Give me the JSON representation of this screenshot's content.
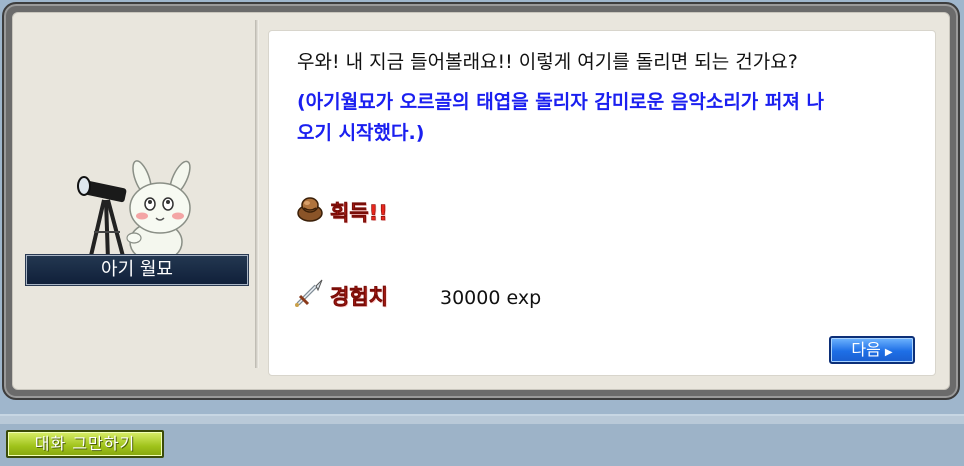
{
  "npc": {
    "name": "아기 월묘",
    "icon": "bunny-with-telescope-icon"
  },
  "dialogue": {
    "line1": "우와! 내 지금 들어볼래요!! 이렇게 여기를 돌리면 되는 건가요?",
    "line2": "(아기월묘가 오르골의 태엽을 돌리자 감미로운 음악소리가 퍼져 나",
    "line3": "오기 시작했다.)"
  },
  "rewards": {
    "item_label": "획득!!",
    "item_icon": "item-bag-icon",
    "exp_label": "경험치",
    "exp_icon": "sword-icon",
    "exp_value": "30000 exp"
  },
  "buttons": {
    "next": "다음",
    "end_chat": "대화 그만하기"
  },
  "colors": {
    "accent_blue": "#1a1ff0",
    "reward_red": "#e8261d",
    "next_button": "#1e6fe6",
    "end_button": "#9fc21a"
  }
}
